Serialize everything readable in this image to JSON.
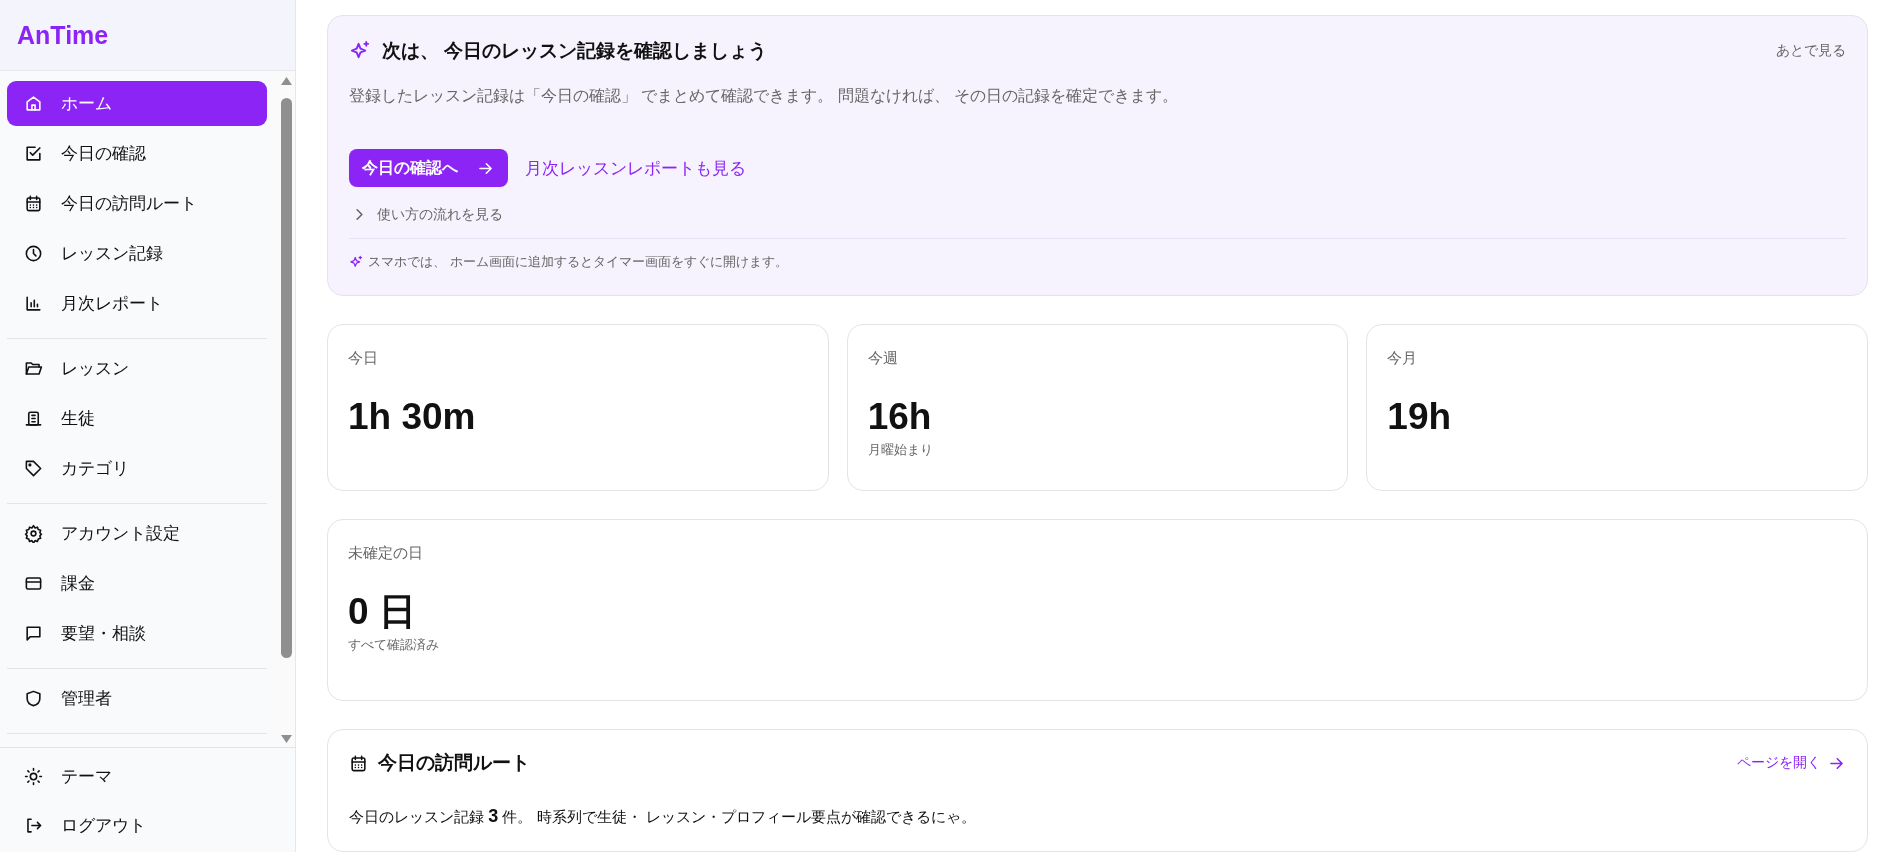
{
  "sidebar": {
    "logo": "AnTime",
    "groups": [
      {
        "items": [
          {
            "label": "ホーム",
            "selected": true
          },
          {
            "label": "今日の確認",
            "selected": false
          },
          {
            "label": "今日の訪問ルート",
            "selected": false
          },
          {
            "label": "レッスン記録",
            "selected": false
          },
          {
            "label": "月次レポート",
            "selected": false
          }
        ]
      },
      {
        "items": [
          {
            "label": "レッスン",
            "selected": false
          },
          {
            "label": "生徒",
            "selected": false
          },
          {
            "label": "カテゴリ",
            "selected": false
          }
        ]
      },
      {
        "items": [
          {
            "label": "アカウント設定",
            "selected": false
          },
          {
            "label": "課金",
            "selected": false
          },
          {
            "label": "要望・相談",
            "selected": false
          }
        ]
      },
      {
        "items": [
          {
            "label": "管理者",
            "selected": false
          }
        ]
      }
    ],
    "footer": [
      {
        "label": "テーマ"
      },
      {
        "label": "ログアウト"
      }
    ]
  },
  "guide": {
    "title": "次は、 今日のレッスン記録を確認しましょう",
    "dismiss": "あとで見る",
    "text": "登録したレッスン記録は「今日の確認」 でまとめて確認できます。 問題なければ、 その日の記録を確定できます。",
    "primary_button": "今日の確認へ",
    "link": "月次レッスンレポートも見る",
    "expander": "使い方の流れを見る",
    "tip": "スマホでは、 ホーム画面に追加するとタイマー画面をすぐに開けます。"
  },
  "stats": [
    {
      "label": "今日",
      "value": "1h 30m"
    },
    {
      "label": "今週",
      "value": "16h",
      "note": "月曜始まり"
    },
    {
      "label": "今月",
      "value": "19h"
    }
  ],
  "unconfirmed": {
    "label": "未確定の日",
    "value": "0 日",
    "note": "すべて確認済み"
  },
  "route": {
    "title": "今日の訪問ルート",
    "link": "ページを開く",
    "text": "今日のレッスン記録 **3** 件。 時系列で生徒・ レッスン・プロフィール要点が確認できるにゃ。"
  }
}
